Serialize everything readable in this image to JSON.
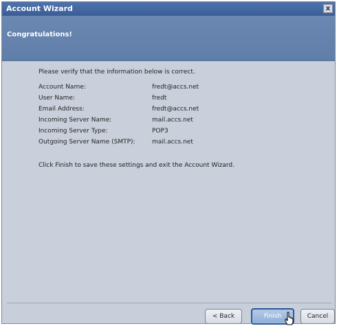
{
  "window": {
    "title": "Account Wizard",
    "close_glyph": "x"
  },
  "header": {
    "title": "Congratulations!"
  },
  "content": {
    "intro": "Please verify that the information below is correct.",
    "fields": [
      {
        "label": "Account Name:",
        "value": "fredt@accs.net"
      },
      {
        "label": "User Name:",
        "value": "fredt"
      },
      {
        "label": "Email Address:",
        "value": "fredt@accs.net"
      },
      {
        "label": "Incoming Server Name:",
        "value": "mail.accs.net"
      },
      {
        "label": "Incoming Server Type:",
        "value": "POP3"
      },
      {
        "label": "Outgoing Server Name (SMTP):",
        "value": "mail.accs.net"
      }
    ],
    "finish_note": "Click Finish to save these settings and exit the Account Wizard."
  },
  "buttons": {
    "back": "< Back",
    "finish": "Finish",
    "cancel": "Cancel"
  },
  "icons": {
    "close": "close-icon",
    "cursor": "hand-cursor-icon"
  }
}
